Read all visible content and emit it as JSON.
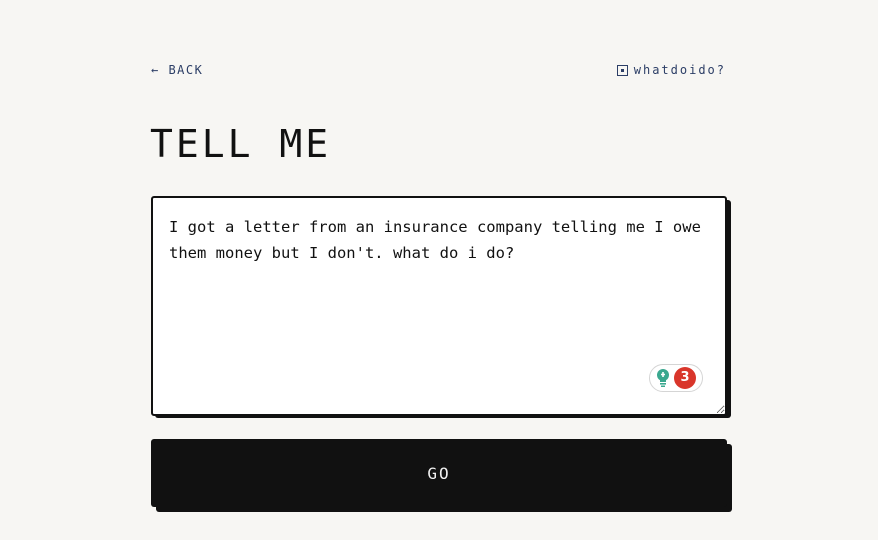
{
  "nav": {
    "back_label": "← BACK",
    "brand_label": "whatdoido?"
  },
  "page": {
    "title": "TELL ME"
  },
  "question": {
    "value": "I got a letter from an insurance company telling me I owe them money but I don't. what do i do?",
    "placeholder": ""
  },
  "grammar_widget": {
    "issue_count": "3",
    "bulb_color": "#3aa88f",
    "badge_color": "#d9362b"
  },
  "submit": {
    "label": "GO"
  }
}
